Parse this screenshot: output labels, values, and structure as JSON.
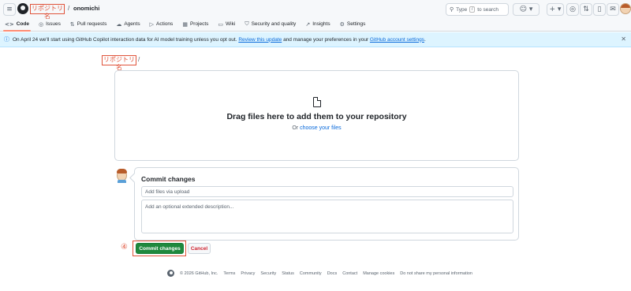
{
  "header": {
    "repo_name": "リポジトリ名",
    "separator": "/",
    "owner": "onomichi",
    "search_placeholder": "Type",
    "search_key": "/",
    "search_suffix": "to search"
  },
  "tabs": [
    {
      "label": "Code",
      "icon": "code-icon",
      "glyph": "<>"
    },
    {
      "label": "Issues",
      "icon": "issue-icon",
      "glyph": "◎"
    },
    {
      "label": "Pull requests",
      "icon": "pull-request-icon",
      "glyph": "⇅"
    },
    {
      "label": "Agents",
      "icon": "agents-icon",
      "glyph": "☁"
    },
    {
      "label": "Actions",
      "icon": "actions-icon",
      "glyph": "▷"
    },
    {
      "label": "Projects",
      "icon": "projects-icon",
      "glyph": "▦"
    },
    {
      "label": "Wiki",
      "icon": "wiki-icon",
      "glyph": "▭"
    },
    {
      "label": "Security and quality",
      "icon": "shield-icon",
      "glyph": "⛉"
    },
    {
      "label": "Insights",
      "icon": "graph-icon",
      "glyph": "↗"
    },
    {
      "label": "Settings",
      "icon": "gear-icon",
      "glyph": "⚙"
    }
  ],
  "banner": {
    "text_before": "On April 24 we'll start using GitHub Copilot interaction data for AI model training unless you opt out.",
    "link1": "Review this update",
    "text_middle": "and manage your preferences in your",
    "link2": "GitHub account settings",
    "text_after": "."
  },
  "upload": {
    "repo_name": "リポジトリ名",
    "separator": "/",
    "drop_title": "Drag files here to add them to your repository",
    "or_text": "Or",
    "choose_link": "choose your files"
  },
  "commit": {
    "title": "Commit changes",
    "summary_placeholder": "Add files via upload",
    "description_placeholder": "Add an optional extended description...",
    "step_marker": "④",
    "commit_button": "Commit changes",
    "cancel_button": "Cancel"
  },
  "footer": {
    "copyright": "© 2026 GitHub, Inc.",
    "links": [
      "Terms",
      "Privacy",
      "Security",
      "Status",
      "Community",
      "Docs",
      "Contact",
      "Manage cookies",
      "Do not share my personal information"
    ]
  },
  "colors": {
    "accent_green": "#1f883d",
    "link_blue": "#0969da",
    "annotation_red": "#e0533a",
    "banner_bg": "#ddf4ff"
  }
}
